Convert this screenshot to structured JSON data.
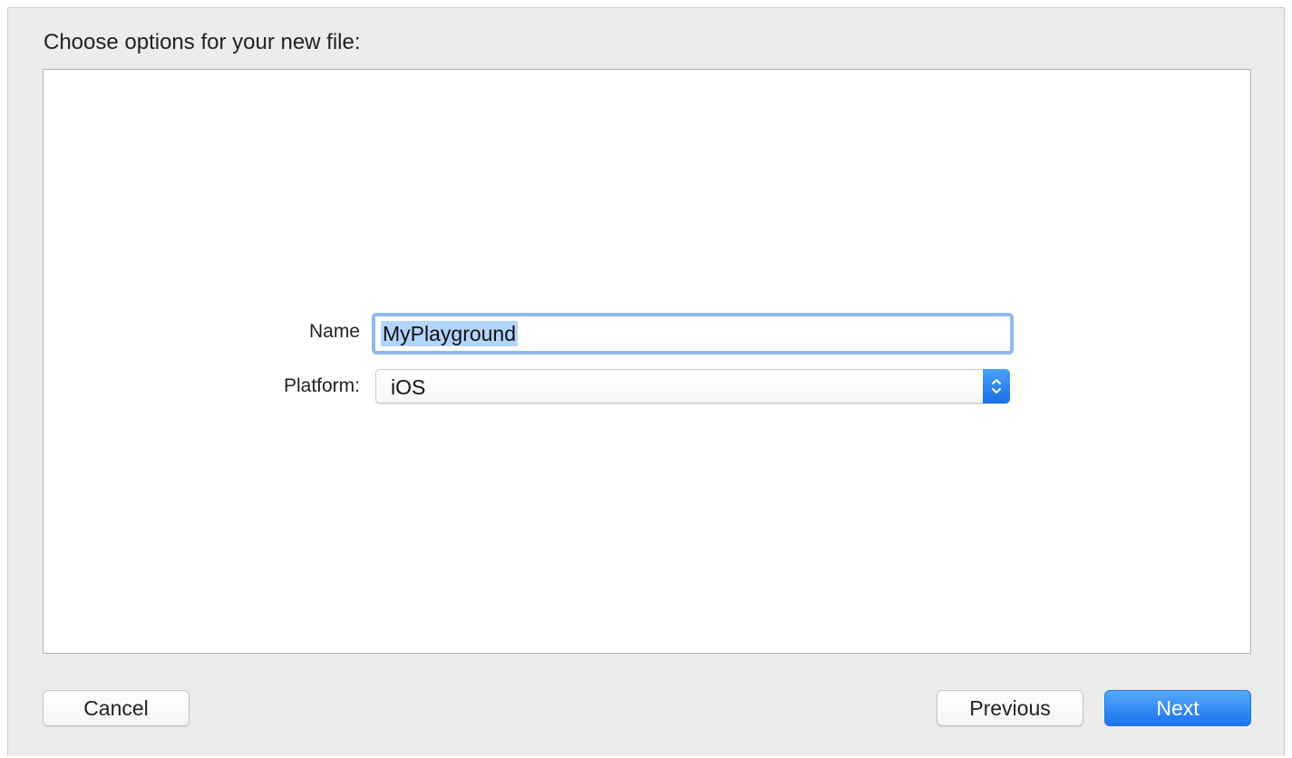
{
  "dialog": {
    "title": "Choose options for your new file:"
  },
  "form": {
    "name_label": "Name",
    "name_value": "MyPlayground",
    "platform_label": "Platform:",
    "platform_value": "iOS",
    "platform_icon": "chevron-up-down-icon"
  },
  "buttons": {
    "cancel": "Cancel",
    "previous": "Previous",
    "next": "Next"
  },
  "colors": {
    "accent": "#1b74ef",
    "focus_ring": "#8fb9ec",
    "selection": "#b3d4fc"
  }
}
